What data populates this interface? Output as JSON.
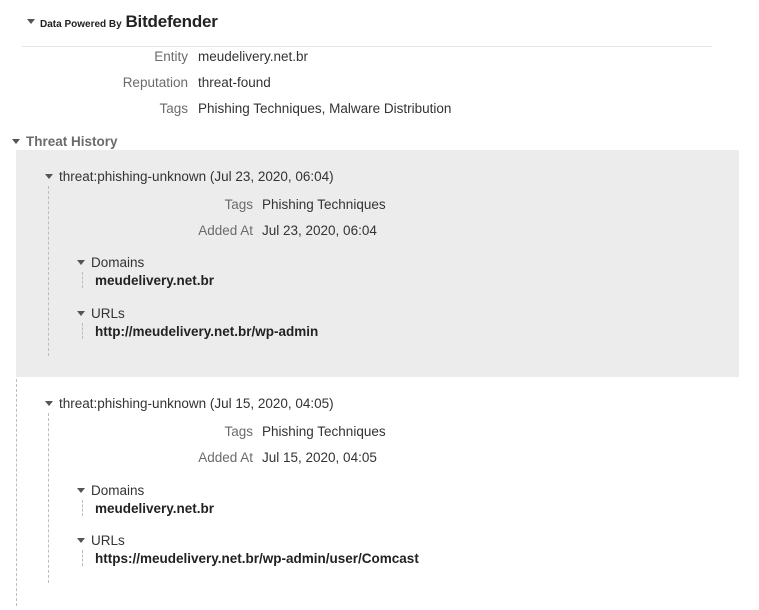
{
  "header": {
    "powered_by": "Data Powered By",
    "brand": "Bitdefender"
  },
  "summary": {
    "entity_label": "Entity",
    "entity_value": "meudelivery.net.br",
    "reputation_label": "Reputation",
    "reputation_value": "threat-found",
    "tags_label": "Tags",
    "tags_value": "Phishing Techniques, Malware Distribution"
  },
  "threat_history": {
    "title": "Threat History",
    "items": [
      {
        "title": "threat:phishing-unknown (Jul 23, 2020, 06:04)",
        "tags_label": "Tags",
        "tags_value": "Phishing Techniques",
        "added_label": "Added At",
        "added_value": "Jul 23, 2020, 06:04",
        "domains_label": "Domains",
        "domains_value": "meudelivery.net.br",
        "urls_label": "URLs",
        "urls_value": "http://meudelivery.net.br/wp-admin"
      },
      {
        "title": "threat:phishing-unknown (Jul 15, 2020, 04:05)",
        "tags_label": "Tags",
        "tags_value": "Phishing Techniques",
        "added_label": "Added At",
        "added_value": "Jul 15, 2020, 04:05",
        "domains_label": "Domains",
        "domains_value": "meudelivery.net.br",
        "urls_label": "URLs",
        "urls_value": "https://meudelivery.net.br/wp-admin/user/Comcast"
      }
    ]
  },
  "colors": {
    "highlight_panel": "#ececec",
    "label_gray": "#6b6b6b",
    "text": "#333333"
  }
}
